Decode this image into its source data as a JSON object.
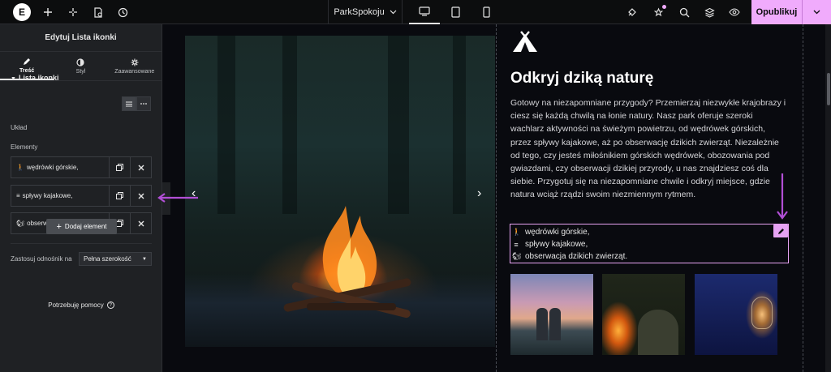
{
  "colors": {
    "accent": "#f0abfc",
    "arrow": "#b24fd6",
    "panel_bg": "#1f2124"
  },
  "topbar": {
    "logo_letter": "E",
    "page_name": "ParkSpokoju",
    "publish_label": "Opublikuj",
    "icons": [
      "plus-icon",
      "sparkle-icon",
      "page-settings-icon",
      "history-icon",
      "plugin-icon",
      "notifications-icon",
      "search-icon",
      "structure-icon",
      "preview-icon"
    ]
  },
  "panel": {
    "title": "Edytuj Lista ikonki",
    "tabs": [
      {
        "label": "Treść",
        "icon": "pencil-icon"
      },
      {
        "label": "Styl",
        "icon": "style-icon"
      },
      {
        "label": "Zaawansowane",
        "icon": "gear-icon"
      }
    ],
    "section_title": "Lista ikonki",
    "layout_label": "Układ",
    "elements_label": "Elementy",
    "items": [
      {
        "label": "wędrówki górskie,",
        "icon": "hiking-icon"
      },
      {
        "label": "spływy kajakowe,",
        "icon": "waves-icon"
      },
      {
        "label": "obserwacja dzikich zwierząt.",
        "icon": "squirrel-icon"
      }
    ],
    "add_label": "Dodaj element",
    "link_label": "Zastosuj odnośnik na",
    "link_value": "Pełna szerokość",
    "help_label": "Potrzebuję pomocy"
  },
  "content": {
    "heading": "Odkryj dziką naturę",
    "paragraph": "Gotowy na niezapomniane przygody? Przemierzaj niezwykłe krajobrazy i ciesz się każdą chwilą na łonie natury. Nasz park oferuje szeroki wachlarz aktywności na świeżym powietrzu, od wędrówek górskich, przez spływy kajakowe, aż po obserwację dzikich zwierząt. Niezależnie od tego, czy jesteś miłośnikiem górskich wędrówek, obozowania pod gwiazdami, czy obserwacji dzikiej przyrody, u nas znajdziesz coś dla siebie. Przygotuj się na niezapomniane chwile i odkryj miejsce, gdzie natura wciąż rządzi swoim niezmiennym rytmem.",
    "list": [
      {
        "label": "wędrówki górskie,",
        "icon": "hiking-icon"
      },
      {
        "label": "spływy kajakowe,",
        "icon": "waves-icon"
      },
      {
        "label": "obserwacja dzikich zwierząt.",
        "icon": "squirrel-icon"
      }
    ]
  }
}
